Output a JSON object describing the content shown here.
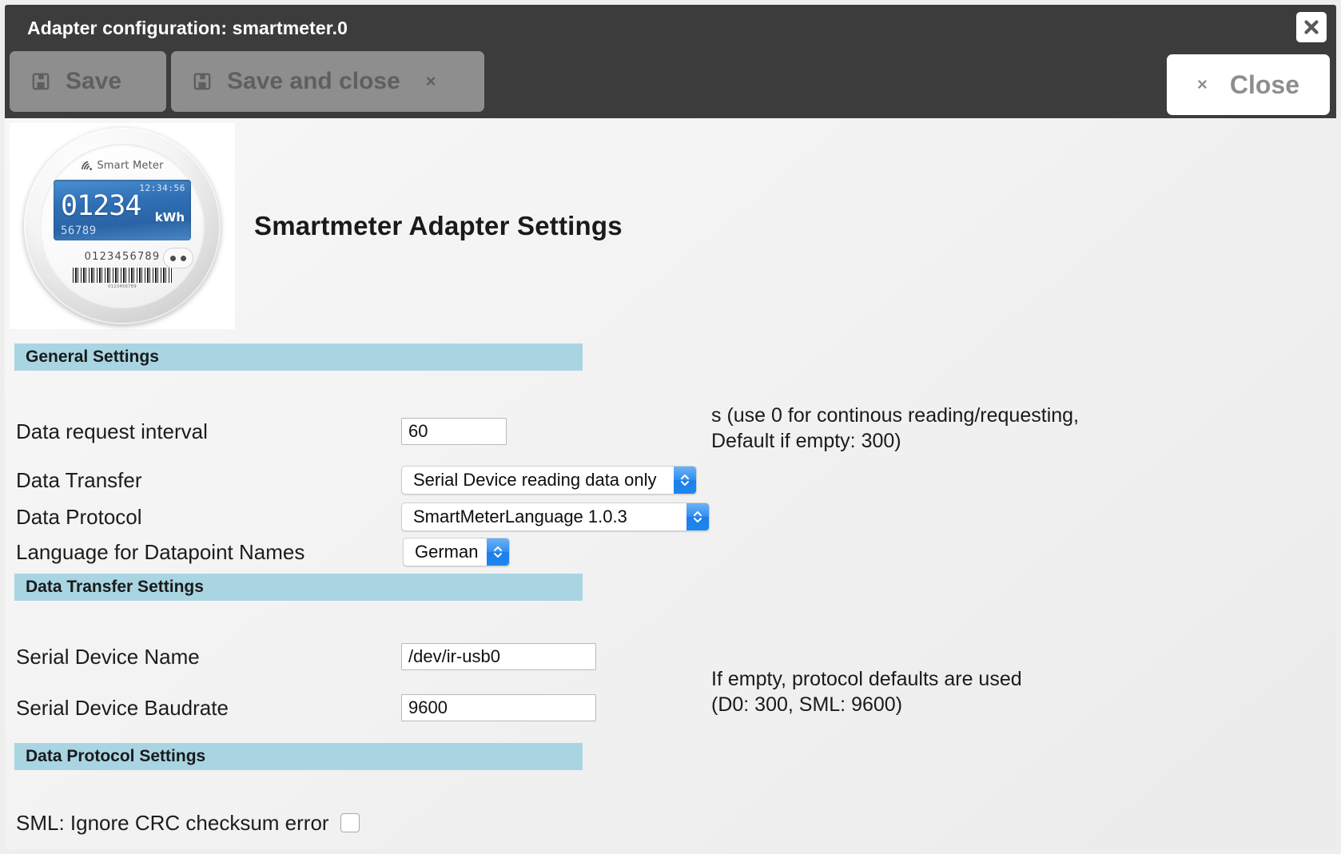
{
  "window": {
    "title": "Adapter configuration: smartmeter.0",
    "close_icon": "close-x-icon"
  },
  "toolbar": {
    "save_label": "Save",
    "save_and_close_label": "Save and close",
    "save_and_close_x": "×",
    "close_label": "Close",
    "close_x": "×",
    "save_icon": "floppy-disk-icon"
  },
  "page": {
    "title": "Smartmeter Adapter Settings"
  },
  "meter_image": {
    "brand": "Smart Meter",
    "time": "12:34:56",
    "reading": "01234",
    "unit": "kWh",
    "sub_reading": "56789",
    "serial": "0123456789",
    "barcode_text": "0123456789"
  },
  "sections": {
    "general": "General Settings",
    "data_transfer": "Data Transfer Settings",
    "data_protocol": "Data Protocol Settings"
  },
  "fields": {
    "data_request_interval": {
      "label": "Data request interval",
      "value": "60",
      "hint": "s (use 0 for continous reading/requesting,\nDefault if empty: 300)"
    },
    "data_transfer": {
      "label": "Data Transfer",
      "value": "Serial Device reading data only"
    },
    "data_protocol": {
      "label": "Data Protocol",
      "value": "SmartMeterLanguage 1.0.3"
    },
    "language": {
      "label": "Language for Datapoint Names",
      "value": "German"
    },
    "serial_device_name": {
      "label": "Serial Device Name",
      "value": "/dev/ir-usb0"
    },
    "serial_device_baudrate": {
      "label": "Serial Device Baudrate",
      "value": "9600",
      "hint": "If empty, protocol defaults are used\n(D0: 300, SML: 9600)"
    },
    "sml_ignore_crc": {
      "label": "SML: Ignore CRC checksum error",
      "checked": false
    }
  },
  "colors": {
    "titlebar_bg": "#3c3c3c",
    "section_bg": "#a9d5e3",
    "select_accent": "#2f8ef0",
    "toolbar_button_bg": "#8e8e8e"
  }
}
